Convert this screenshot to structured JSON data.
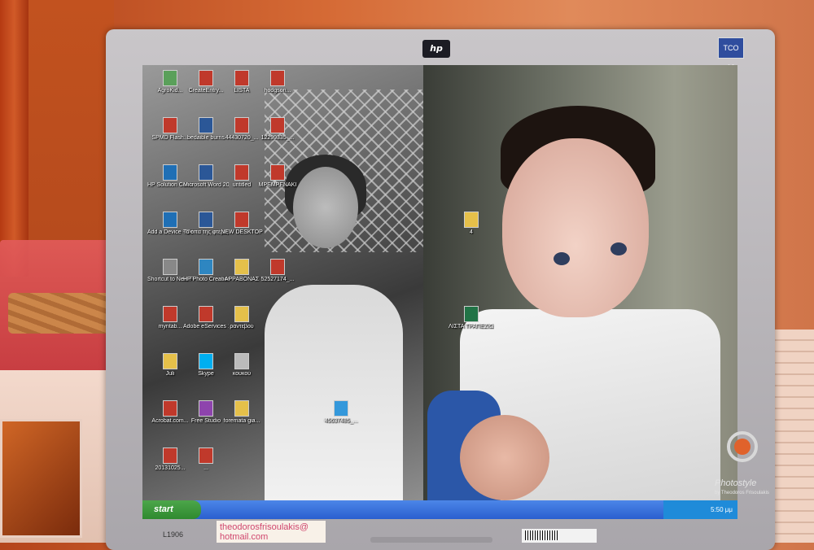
{
  "monitor": {
    "brand_logo": "hp",
    "energy_badge": "TCO 03",
    "model_label": "L1906",
    "sticky_note": "theodorosfrisoulakis@ hotmail.com"
  },
  "desktop": {
    "icons": [
      {
        "label": "AgroKid...",
        "icon": "recycle-bin-icon",
        "color": "#5aa05a"
      },
      {
        "label": "CreateEntry...",
        "icon": "pdf-file-icon",
        "color": "#c0392b"
      },
      {
        "label": "LISTA",
        "icon": "pdf-file-icon",
        "color": "#c0392b"
      },
      {
        "label": "hodgson...",
        "icon": "pdf-file-icon",
        "color": "#c0392b"
      },
      {
        "label": "SPMD Flash...",
        "icon": "flash-icon",
        "color": "#c0392b"
      },
      {
        "label": "bedaible burns",
        "icon": "word-doc-icon",
        "color": "#2b5797"
      },
      {
        "label": "44430720_...",
        "icon": "pdf-file-icon",
        "color": "#c0392b"
      },
      {
        "label": "12299335_...",
        "icon": "pdf-file-icon",
        "color": "#c0392b"
      },
      {
        "label": "HP Solution Center",
        "icon": "hp-icon",
        "color": "#1f6fb5"
      },
      {
        "label": "Microsoft Word 2010",
        "icon": "word-app-icon",
        "color": "#2b5797"
      },
      {
        "label": "untitled",
        "icon": "pdf-file-icon",
        "color": "#c0392b"
      },
      {
        "label": "ΜΡΕΜΡΕΝΑΚΙ",
        "icon": "pdf-file-icon",
        "color": "#c0392b"
      },
      {
        "label": "Add a Device - DeskJet F24...",
        "icon": "hp-icon",
        "color": "#1f6fb5"
      },
      {
        "label": "Το όπα της φτέρις...",
        "icon": "word-doc-icon",
        "color": "#2b5797"
      },
      {
        "label": "NEW DESKTOP",
        "icon": "pdf-file-icon",
        "color": "#c0392b"
      },
      {
        "label": "Shortcut to New Fol...",
        "icon": "shortcut-icon",
        "color": "#888888"
      },
      {
        "label": "HP Photo Creations",
        "icon": "hp-photo-icon",
        "color": "#2e86c1"
      },
      {
        "label": "ΑΡΡΑΒΟΝΑΣ",
        "icon": "folder-icon",
        "color": "#e5c04a"
      },
      {
        "label": "52527174_...",
        "icon": "pdf-file-icon",
        "color": "#c0392b"
      },
      {
        "label": "myntab...",
        "icon": "pdf-file-icon",
        "color": "#c0392b"
      },
      {
        "label": "Adobe eServices 15",
        "icon": "adobe-icon",
        "color": "#c0392b"
      },
      {
        "label": "ραντεβού",
        "icon": "folder-icon",
        "color": "#e5c04a"
      },
      {
        "label": "Juli",
        "icon": "folder-icon",
        "color": "#e5c04a"
      },
      {
        "label": "Skype",
        "icon": "skype-icon",
        "color": "#00aff0"
      },
      {
        "label": "κουκού",
        "icon": "file-icon",
        "color": "#bbbbbb"
      },
      {
        "label": "Acrobat.com...",
        "icon": "acrobat-icon",
        "color": "#c0392b"
      },
      {
        "label": "Free Studio",
        "icon": "freestudio-icon",
        "color": "#8e44ad"
      },
      {
        "label": "foremata gia...",
        "icon": "folder-icon",
        "color": "#e5c04a"
      },
      {
        "label": "20131025...",
        "icon": "pdf-file-icon",
        "color": "#c0392b"
      },
      {
        "label": "...",
        "icon": "pdf-file-icon",
        "color": "#c0392b"
      },
      {
        "label": "45637485_...",
        "icon": "image-file-icon",
        "color": "#3498db"
      },
      {
        "label": "ΛΙΣΤΑ ΤΡΑΠΕΖΙΩΝ",
        "icon": "excel-file-icon",
        "color": "#217346"
      },
      {
        "label": "4",
        "icon": "folder-icon",
        "color": "#e5c04a"
      }
    ]
  },
  "taskbar": {
    "start_label": "start",
    "tray_time": "5:50 μμ"
  },
  "watermark": {
    "name": "Photostyle",
    "sub": "by Theodoros Frisoulakis"
  }
}
